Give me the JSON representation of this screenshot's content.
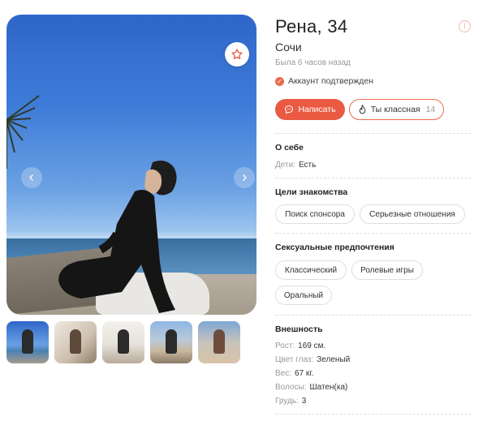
{
  "profile": {
    "name_age": "Рена, 34",
    "city": "Сочи",
    "last_seen": "Была 6 часов назад",
    "verified_label": "Аккаунт подтвержден",
    "write_button": "Написать",
    "like_button": "Ты классная",
    "like_count": "14"
  },
  "about": {
    "title": "О себе",
    "kids_label": "Дети:",
    "kids_value": "Есть"
  },
  "goals": {
    "title": "Цели знакомства",
    "chips": [
      "Поиск спонсора",
      "Серьезные отношения"
    ]
  },
  "preferences": {
    "title": "Сексуальные предпочтения",
    "chips": [
      "Классический",
      "Ролевые игры",
      "Оральный"
    ]
  },
  "appearance": {
    "title": "Внешность",
    "rows": [
      {
        "label": "Рост:",
        "value": "169 см."
      },
      {
        "label": "Цвет глаз:",
        "value": "Зеленый"
      },
      {
        "label": "Вес:",
        "value": "67 кг."
      },
      {
        "label": "Волосы:",
        "value": "Шатен(ка)"
      },
      {
        "label": "Грудь:",
        "value": "3"
      }
    ]
  },
  "icons": {
    "favorite": "star-icon",
    "prev": "chevron-left-icon",
    "next": "chevron-right-icon",
    "info": "info-icon",
    "verified": "check-circle-icon",
    "write": "chat-bubble-icon",
    "like": "flame-icon"
  },
  "colors": {
    "accent": "#ea5a43",
    "muted": "#999999"
  }
}
